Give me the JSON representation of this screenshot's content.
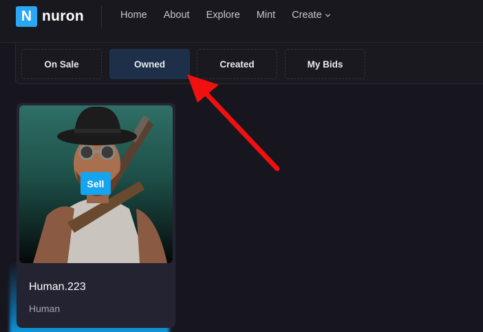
{
  "header": {
    "logo_letter": "N",
    "logo_text": "nuron",
    "nav": [
      {
        "label": "Home"
      },
      {
        "label": "About"
      },
      {
        "label": "Explore"
      },
      {
        "label": "Mint"
      },
      {
        "label": "Create"
      }
    ]
  },
  "tabs": [
    {
      "label": "On Sale",
      "active": false
    },
    {
      "label": "Owned",
      "active": true
    },
    {
      "label": "Created",
      "active": false
    },
    {
      "label": "My Bids",
      "active": false
    }
  ],
  "card": {
    "title": "Human.223",
    "subtitle": "Human",
    "sell_label": "Sell"
  },
  "colors": {
    "accent": "#15a4f0",
    "active_tab": "#1e3049",
    "annotation_arrow": "#f01010"
  }
}
